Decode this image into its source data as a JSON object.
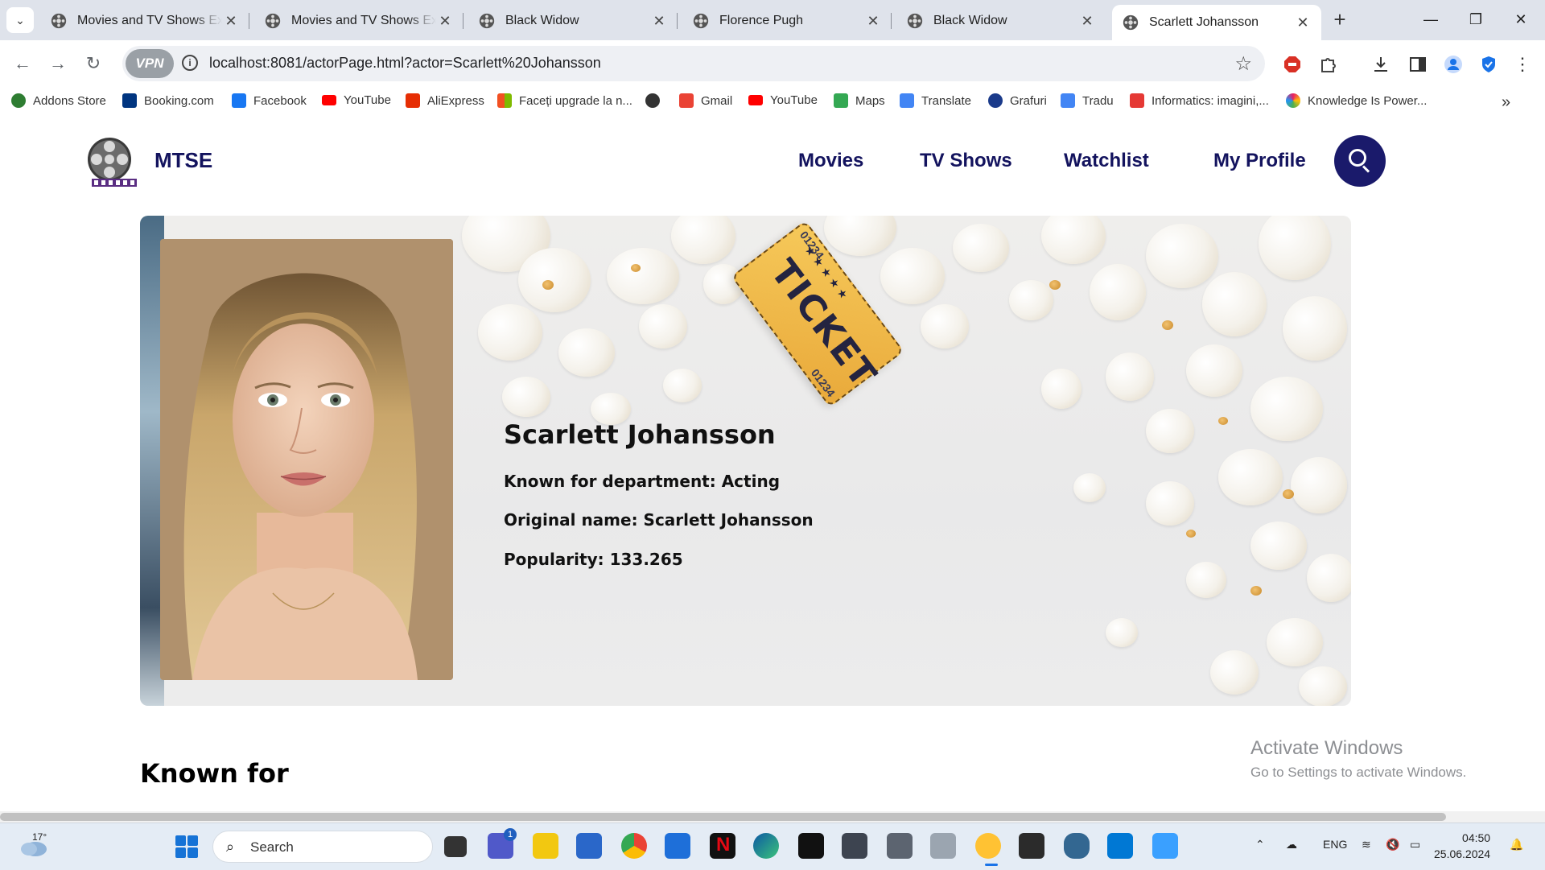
{
  "browser": {
    "tabs": [
      {
        "title": "Movies and TV Shows Expl",
        "active": false
      },
      {
        "title": "Movies and TV Shows Expl",
        "active": false
      },
      {
        "title": "Black Widow",
        "active": false
      },
      {
        "title": "Florence Pugh",
        "active": false
      },
      {
        "title": "Black Widow",
        "active": false
      },
      {
        "title": "Scarlett Johansson",
        "active": true
      }
    ],
    "new_tab": "+",
    "close_glyph": "✕",
    "window_controls": {
      "minimize": "—",
      "restore": "❐",
      "close": "✕"
    },
    "vpn_label": "VPN",
    "url": "localhost:8081/actorPage.html?actor=Scarlett%20Johansson",
    "bookmarks": [
      {
        "label": "Addons Store",
        "color": "#2e7d32"
      },
      {
        "label": "Booking.com",
        "color": "#003580"
      },
      {
        "label": "Facebook",
        "color": "#1877f2"
      },
      {
        "label": "YouTube",
        "color": "#ff0000"
      },
      {
        "label": "AliExpress",
        "color": "#e62e04"
      },
      {
        "label": "Faceți upgrade la n...",
        "color": "#f25022"
      },
      {
        "label": "",
        "color": "#333333"
      },
      {
        "label": "Gmail",
        "color": "#ea4335"
      },
      {
        "label": "YouTube",
        "color": "#ff0000"
      },
      {
        "label": "Maps",
        "color": "#34a853"
      },
      {
        "label": "Translate",
        "color": "#4285f4"
      },
      {
        "label": "Grafuri",
        "color": "#1a3a8a"
      },
      {
        "label": "Tradu",
        "color": "#4285f4"
      },
      {
        "label": "Informatics: imagini,...",
        "color": "#e53935"
      },
      {
        "label": "Knowledge Is Power...",
        "color": "#e91e63"
      }
    ],
    "bookmarks_overflow": "»"
  },
  "site": {
    "brand": "MTSE",
    "nav": [
      "Movies",
      "TV Shows",
      "Watchlist",
      "My Profile"
    ]
  },
  "actor": {
    "name": "Scarlett Johansson",
    "department_line": "Known for department: Acting",
    "original_name_line": "Original name: Scarlett Johansson",
    "popularity_line": "Popularity: 133.265"
  },
  "hero": {
    "ticket_word": "TICKET",
    "ticket_number": "01234"
  },
  "sections": {
    "known_for": "Known for"
  },
  "watermark": {
    "line1": "Activate Windows",
    "line2": "Go to Settings to activate Windows."
  },
  "taskbar": {
    "temperature": "17°",
    "search_label": "Search",
    "teams_badge": "1",
    "language": "ENG",
    "time": "04:50",
    "date": "25.06.2024"
  }
}
